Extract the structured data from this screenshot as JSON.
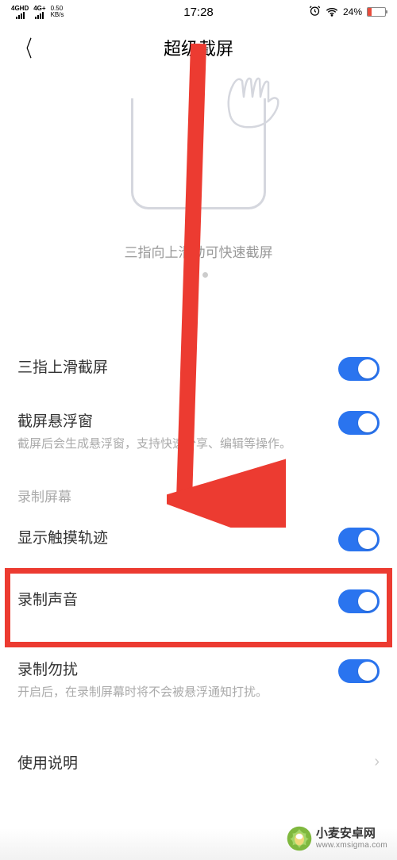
{
  "status": {
    "network1": "4GHD",
    "network2": "4G+",
    "speed_value": "0.50",
    "speed_unit": "KB/s",
    "time": "17:28",
    "battery_pct": "24%"
  },
  "nav": {
    "title": "超级截屏"
  },
  "preview": {
    "hint": "三指向上滑动可快速截屏"
  },
  "settings": {
    "three_finger": {
      "title": "三指上滑截屏"
    },
    "float_window": {
      "title": "截屏悬浮窗",
      "desc": "截屏后会生成悬浮窗，支持快速分享、编辑等操作。"
    },
    "section_record": "录制屏幕",
    "show_touch": {
      "title": "显示触摸轨迹"
    },
    "record_audio": {
      "title": "录制声音"
    },
    "dnd": {
      "title": "录制勿扰",
      "desc": "开启后，在录制屏幕时将不会被悬浮通知打扰。"
    },
    "instructions": {
      "title": "使用说明"
    }
  },
  "watermark": {
    "cn": "小麦安卓网",
    "url": "www.xmsigma.com"
  }
}
